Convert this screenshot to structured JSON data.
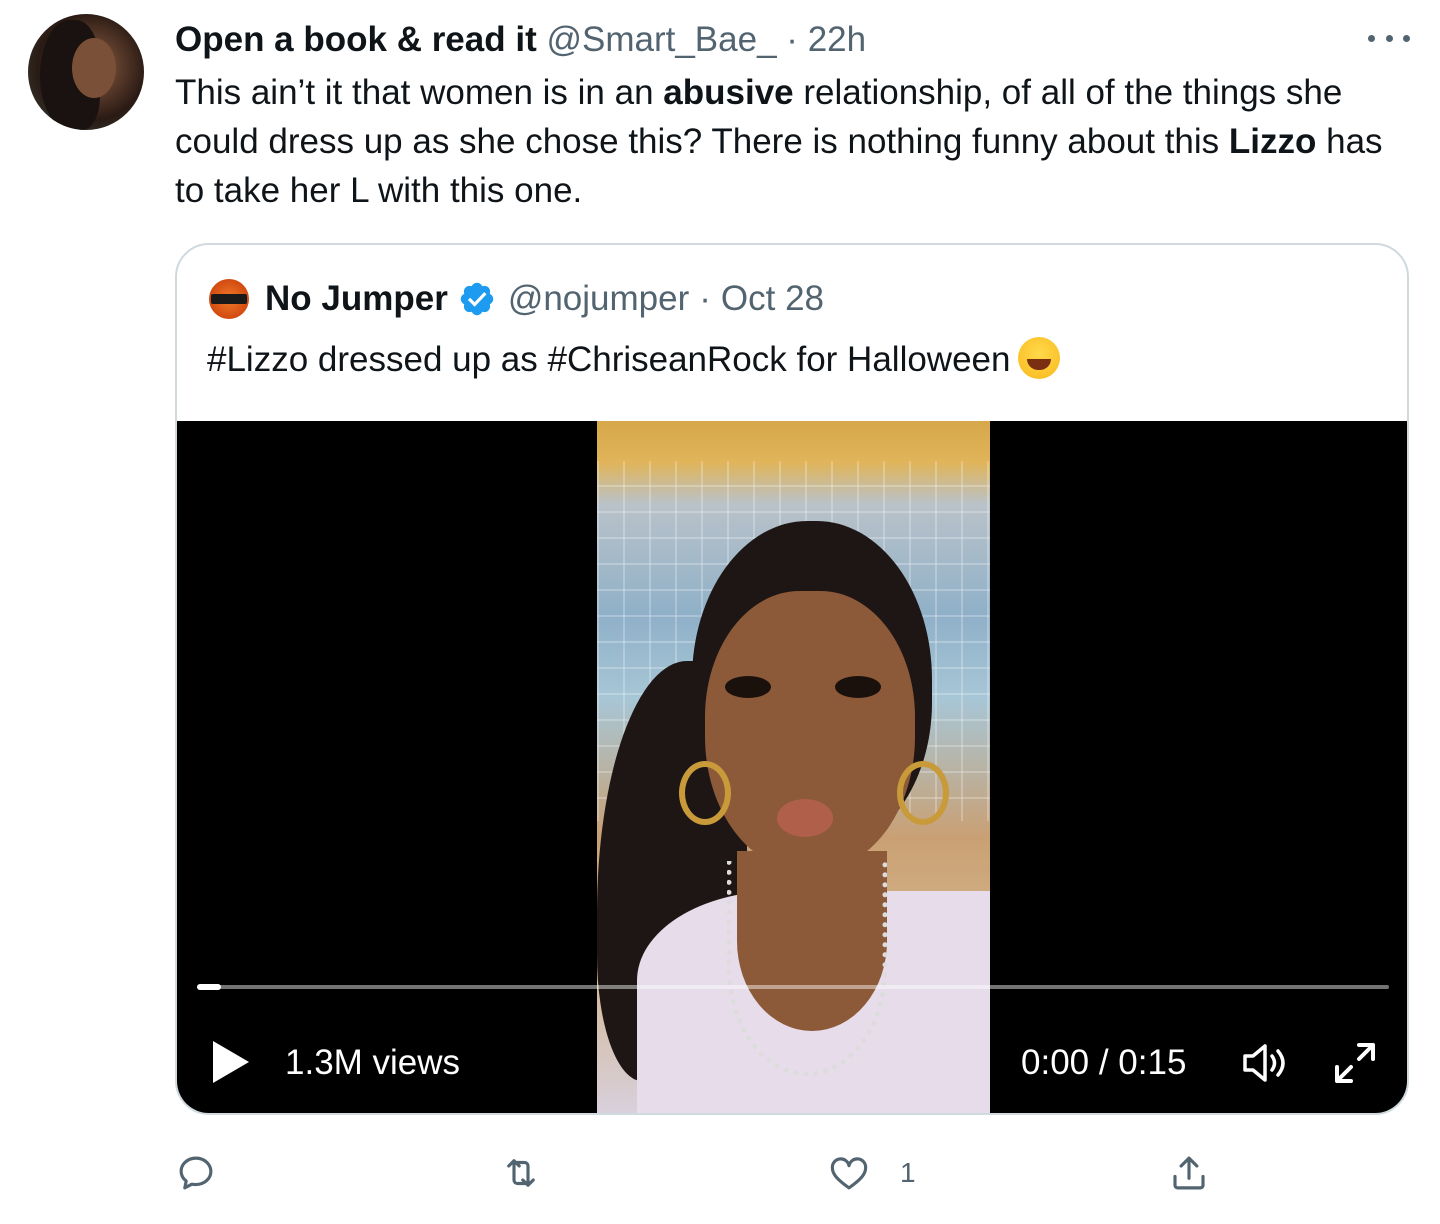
{
  "tweet": {
    "author_name": "Open a book & read it",
    "handle": "@Smart_Bae_",
    "separator": "·",
    "time": "22h",
    "text_parts": [
      {
        "t": "This ain’t it that women is in an ",
        "b": false
      },
      {
        "t": "abusive",
        "b": true
      },
      {
        "t": " relationship, of all of the things she could dress up as she chose this? There is nothing funny about this ",
        "b": false
      },
      {
        "t": "Lizzo",
        "b": true
      },
      {
        "t": " has to take her L with this one.",
        "b": false
      }
    ]
  },
  "quoted": {
    "author_name": "No Jumper",
    "handle": "@nojumper",
    "separator": "·",
    "date": "Oct 28",
    "text": "#Lizzo dressed up as #ChriseanRock for Halloween",
    "emoji_icon": "face-with-tears-of-joy-emoji"
  },
  "video": {
    "views": "1.3M views",
    "time": "0:00 / 0:15",
    "progress": 0.02
  },
  "actions": {
    "like_count": "1"
  },
  "colors": {
    "text": "#0f1419",
    "muted": "#536471",
    "verified": "#1d9bf0",
    "border": "#cfd9de"
  }
}
